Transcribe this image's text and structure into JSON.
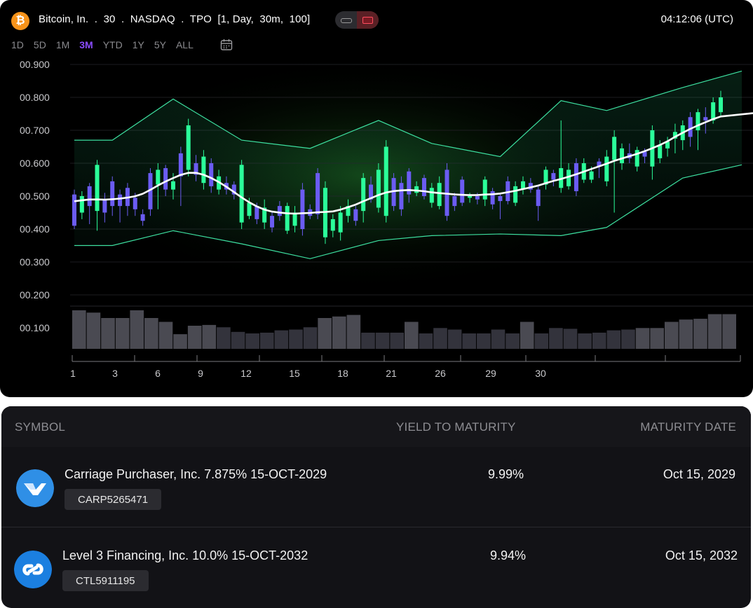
{
  "header": {
    "ticker": "Bitcoin, In.  .  30  .  NASDAQ  .  TPO  [1, Day,  30m,  100]",
    "clock": "04:12:06 (UTC)"
  },
  "ranges": [
    "1D",
    "5D",
    "1M",
    "3M",
    "YTD",
    "1Y",
    "5Y",
    "ALL"
  ],
  "active_range": "3M",
  "colors": {
    "bull": "#2bff9a",
    "bear": "#6b5cf2",
    "band": "#3de0a0",
    "volume": "#4a4a52",
    "accent": "#8a4dff"
  },
  "chart_data": {
    "type": "candlestick",
    "y_tick_labels": [
      "00.900",
      "00.800",
      "00.700",
      "00.600",
      "00.500",
      "00.400",
      "00.300",
      "00.200",
      "00.100"
    ],
    "x_tick_labels": [
      "1",
      "3",
      "6",
      "9",
      "12",
      "15",
      "18",
      "21",
      "26",
      "29",
      "30"
    ],
    "ylim": [
      100,
      900
    ],
    "candles": [
      [
        505,
        410,
        520,
        400
      ],
      [
        450,
        500,
        515,
        430
      ],
      [
        530,
        470,
        540,
        415
      ],
      [
        455,
        595,
        610,
        395
      ],
      [
        490,
        450,
        510,
        420
      ],
      [
        545,
        470,
        560,
        440
      ],
      [
        505,
        470,
        520,
        420
      ],
      [
        525,
        470,
        540,
        440
      ],
      [
        495,
        460,
        510,
        440
      ],
      [
        445,
        425,
        460,
        410
      ],
      [
        570,
        460,
        585,
        440
      ],
      [
        535,
        580,
        600,
        460
      ],
      [
        585,
        520,
        595,
        500
      ],
      [
        520,
        545,
        570,
        490
      ],
      [
        630,
        560,
        650,
        470
      ],
      [
        580,
        715,
        735,
        560
      ],
      [
        600,
        565,
        625,
        545
      ],
      [
        540,
        620,
        640,
        520
      ],
      [
        600,
        530,
        615,
        510
      ],
      [
        520,
        560,
        580,
        505
      ],
      [
        540,
        520,
        560,
        505
      ],
      [
        535,
        505,
        545,
        490
      ],
      [
        420,
        595,
        610,
        400
      ],
      [
        440,
        480,
        495,
        430
      ],
      [
        470,
        430,
        480,
        415
      ],
      [
        420,
        465,
        490,
        400
      ],
      [
        440,
        405,
        455,
        390
      ],
      [
        470,
        440,
        485,
        425
      ],
      [
        395,
        470,
        480,
        385
      ],
      [
        410,
        450,
        470,
        390
      ],
      [
        520,
        400,
        540,
        380
      ],
      [
        460,
        440,
        475,
        430
      ],
      [
        570,
        445,
        585,
        430
      ],
      [
        375,
        525,
        545,
        355
      ],
      [
        395,
        430,
        445,
        375
      ],
      [
        390,
        450,
        470,
        365
      ],
      [
        440,
        470,
        490,
        420
      ],
      [
        460,
        425,
        470,
        410
      ],
      [
        455,
        555,
        570,
        420
      ],
      [
        535,
        490,
        560,
        480
      ],
      [
        465,
        580,
        600,
        450
      ],
      [
        440,
        650,
        670,
        420
      ],
      [
        555,
        470,
        570,
        455
      ],
      [
        540,
        460,
        560,
        440
      ],
      [
        575,
        505,
        585,
        480
      ],
      [
        510,
        530,
        545,
        500
      ],
      [
        555,
        500,
        565,
        490
      ],
      [
        480,
        525,
        540,
        465
      ],
      [
        470,
        540,
        560,
        460
      ],
      [
        580,
        440,
        600,
        425
      ],
      [
        500,
        470,
        510,
        455
      ],
      [
        550,
        480,
        560,
        470
      ],
      [
        495,
        500,
        510,
        480
      ],
      [
        500,
        490,
        510,
        475
      ],
      [
        490,
        550,
        560,
        470
      ],
      [
        515,
        475,
        525,
        460
      ],
      [
        500,
        485,
        510,
        430
      ],
      [
        545,
        485,
        560,
        475
      ],
      [
        480,
        530,
        545,
        470
      ],
      [
        520,
        545,
        560,
        505
      ],
      [
        540,
        520,
        555,
        510
      ],
      [
        520,
        470,
        535,
        425
      ],
      [
        535,
        580,
        590,
        520
      ],
      [
        570,
        550,
        580,
        530
      ],
      [
        525,
        585,
        730,
        510
      ],
      [
        530,
        580,
        600,
        520
      ],
      [
        600,
        515,
        615,
        500
      ],
      [
        550,
        600,
        615,
        540
      ],
      [
        550,
        575,
        590,
        540
      ],
      [
        605,
        590,
        615,
        555
      ],
      [
        545,
        620,
        640,
        530
      ],
      [
        610,
        680,
        700,
        450
      ],
      [
        600,
        645,
        660,
        580
      ],
      [
        630,
        615,
        660,
        600
      ],
      [
        590,
        640,
        650,
        575
      ],
      [
        635,
        620,
        645,
        600
      ],
      [
        590,
        700,
        715,
        550
      ],
      [
        615,
        655,
        670,
        600
      ],
      [
        645,
        665,
        680,
        620
      ],
      [
        675,
        695,
        720,
        630
      ],
      [
        670,
        715,
        730,
        640
      ],
      [
        740,
        680,
        755,
        650
      ],
      [
        700,
        755,
        765,
        640
      ],
      [
        740,
        730,
        770,
        690
      ],
      [
        730,
        785,
        800,
        720
      ],
      [
        755,
        800,
        820,
        745
      ]
    ],
    "volume": [
      50,
      47,
      40,
      40,
      50,
      40,
      35,
      19,
      30,
      31,
      28,
      22,
      20,
      21,
      24,
      25,
      28,
      40,
      42,
      44,
      21,
      21,
      21,
      35,
      20,
      27,
      25,
      20,
      20,
      25,
      20,
      35,
      20,
      27,
      26,
      20,
      21,
      24,
      25,
      27,
      27,
      35,
      38,
      39,
      45,
      45
    ]
  },
  "table": {
    "headers": {
      "symbol": "SYMBOL",
      "yield": "YIELD TO MATURITY",
      "maturity": "MATURITY DATE"
    },
    "rows": [
      {
        "name": "Carriage Purchaser, Inc. 7.875% 15-OCT-2029",
        "id": "CARP5265471",
        "yield": "9.99%",
        "maturity": "Oct 15, 2029"
      },
      {
        "name": "Level 3 Financing, Inc. 10.0% 15-OCT-2032",
        "id": "CTL5911195",
        "yield": "9.94%",
        "maturity": "Oct 15, 2032"
      }
    ]
  }
}
